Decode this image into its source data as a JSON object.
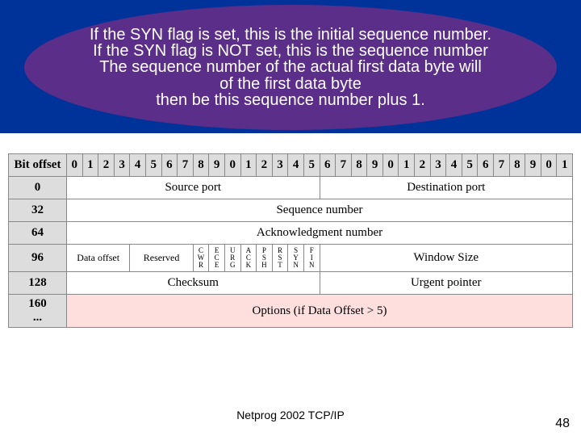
{
  "callout": {
    "line1": "If the SYN flag is set, this is the initial sequence number.",
    "line2": "If the SYN flag is NOT set, this is the sequence number",
    "line3": "The sequence number of the actual first data byte will",
    "line4": "of the first data byte",
    "line5": "then be this sequence number plus 1."
  },
  "table": {
    "header_label": "Bit offset",
    "bit_cols": [
      "0",
      "1",
      "2",
      "3",
      "4",
      "5",
      "6",
      "7",
      "8",
      "9",
      "0",
      "1",
      "2",
      "3",
      "4",
      "5",
      "6",
      "7",
      "8",
      "9",
      "0",
      "1",
      "2",
      "3",
      "4",
      "5",
      "6",
      "7",
      "8",
      "9",
      "0",
      "1"
    ],
    "rows": {
      "r0_offset": "0",
      "r0_a": "Source port",
      "r0_b": "Destination port",
      "r32_offset": "32",
      "r32_a": "Sequence number",
      "r64_offset": "64",
      "r64_a": "Acknowledgment number",
      "r96_offset": "96",
      "r96_dataoffset": "Data offset",
      "r96_reserved": "Reserved",
      "flags": [
        "CWR",
        "ECE",
        "URG",
        "ACK",
        "PSH",
        "RST",
        "SYN",
        "FIN"
      ],
      "r96_window": "Window Size",
      "r128_offset": "128",
      "r128_a": "Checksum",
      "r128_b": "Urgent pointer",
      "r160_offset": "160\n...",
      "r160_a": "Options (if Data Offset > 5)"
    }
  },
  "footer": "Netprog 2002  TCP/IP",
  "page": "48"
}
